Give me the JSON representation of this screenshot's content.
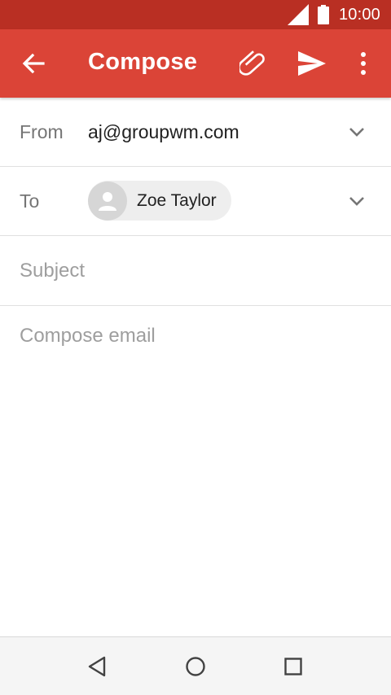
{
  "status_bar": {
    "time": "10:00",
    "icons": [
      "cellular-signal-icon",
      "battery-icon"
    ]
  },
  "app_bar": {
    "title": "Compose",
    "icons": [
      "back-arrow-icon",
      "attach-icon",
      "send-icon",
      "more-vert-icon"
    ]
  },
  "from": {
    "label": "From",
    "value": "aj@groupwm.com"
  },
  "to": {
    "label": "To",
    "recipient": "Zoe Taylor"
  },
  "subject": {
    "value": "",
    "placeholder": "Subject"
  },
  "body": {
    "value": "",
    "placeholder": "Compose email"
  },
  "colors": {
    "status_bar": "#b92f23",
    "app_bar": "#db4437",
    "chip_bg": "#eeeeee"
  },
  "nav_bar": {
    "icons": [
      "back-triangle-icon",
      "home-circle-icon",
      "recents-square-icon"
    ]
  }
}
